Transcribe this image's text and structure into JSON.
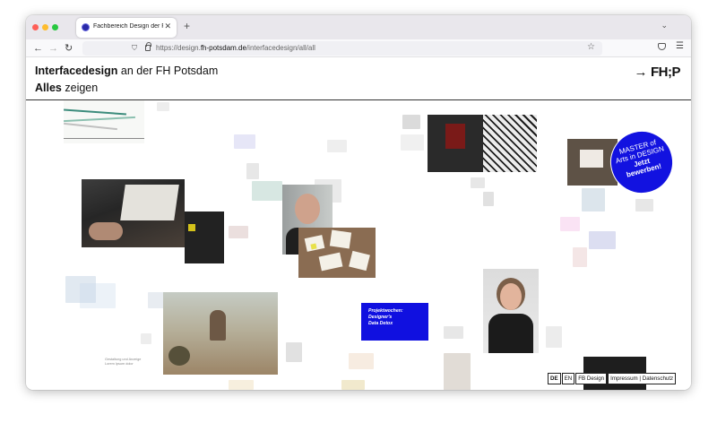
{
  "browser": {
    "tab_title": "Fachbereich Design der Fachho",
    "tab_close": "✕",
    "new_tab": "+",
    "tab_list": "⌄",
    "url_prefix": "https://design.",
    "url_domain": "fh-potsdam.de",
    "url_path": "/interfacedesign/all/all",
    "icons": [
      "back-arrow-icon",
      "forward-arrow-icon",
      "reload-icon",
      "shield-icon",
      "lock-icon",
      "star-icon",
      "pocket-icon",
      "hamburger-menu-icon"
    ]
  },
  "header": {
    "title_bold": "Interfacedesign",
    "title_rest": " an der FH Potsdam",
    "subtitle_bold": "Alles",
    "subtitle_rest": " zeigen",
    "logo_arrow": "→",
    "logo_text": "FH;P"
  },
  "promo_badge": {
    "line1": "MASTER of",
    "line2": "Arts in DESIGN",
    "line3": "Jetzt",
    "line4": "bewerben!"
  },
  "blue_card": {
    "line1": "Projektwochen:",
    "line2": "Designer's",
    "line3": "Data Detox"
  },
  "caption": {
    "line1": "Gestaltung und Anzeige",
    "line2": "Lorem Ipsum dolor"
  },
  "footer_links": {
    "lang_de": "DE",
    "lang_en": "EN",
    "fb_design": "FB Design",
    "legal": "Impressum | Datenschutz"
  },
  "colors": {
    "brand_blue": "#1212e0",
    "header_rule": "#333333"
  }
}
